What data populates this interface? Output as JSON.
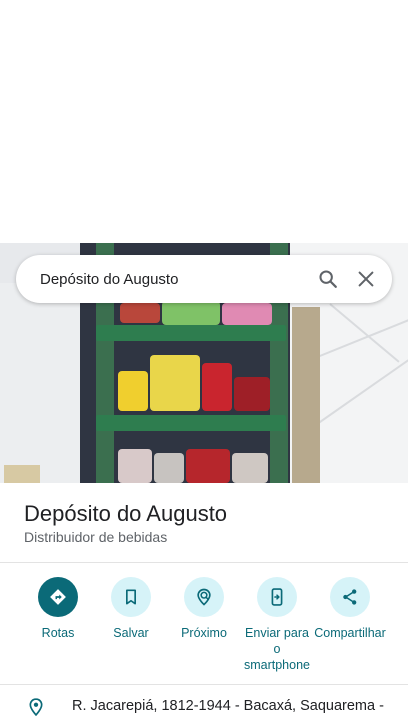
{
  "search": {
    "query": "Depósito do Augusto"
  },
  "place": {
    "name": "Depósito do Augusto",
    "category": "Distribuidor de bebidas",
    "address": "R. Jacarepiá, 1812-1944 - Bacaxá, Saquarema -"
  },
  "actions": [
    {
      "label": "Rotas",
      "icon": "directions-icon"
    },
    {
      "label": "Salvar",
      "icon": "bookmark-icon"
    },
    {
      "label": "Próximo",
      "icon": "nearby-icon"
    },
    {
      "label": "Enviar para o smartphone",
      "icon": "send-to-phone-icon"
    },
    {
      "label": "Compartilhar",
      "icon": "share-icon"
    }
  ],
  "colors": {
    "accent": "#0b6a78",
    "accent_light": "#d6f3f8"
  }
}
